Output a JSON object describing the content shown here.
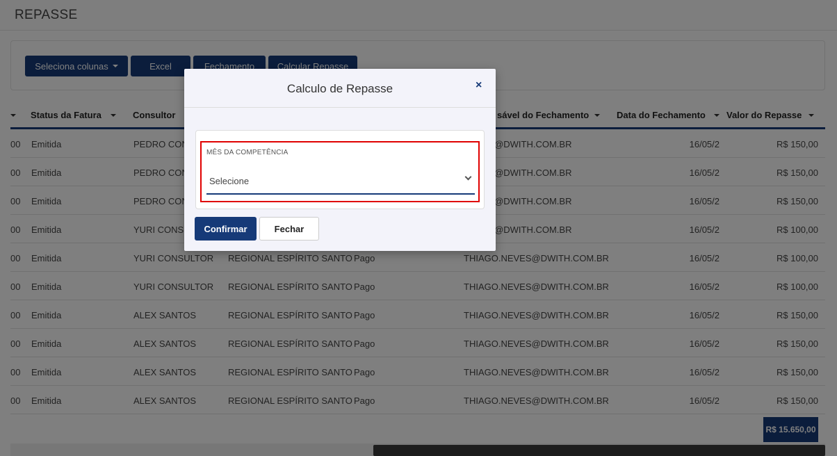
{
  "page": {
    "title": "REPASSE"
  },
  "toolbar": {
    "select_columns_label": "Seleciona colunas",
    "excel_label": "Excel",
    "fechamento_label": "Fechamento",
    "calcular_label": "Calcular Repasse"
  },
  "table": {
    "headers": {
      "status": "Status da Fatura",
      "consultor": "Consultor",
      "responsavel": "sável do Fechamento",
      "data": "Data do Fechamento",
      "valor": "Valor do Repasse"
    },
    "rows": [
      {
        "prefix": "00",
        "status": "Emitida",
        "consultor": "PEDRO CONS",
        "regional": "",
        "situacao": "",
        "responsavel": "NEVES@DWITH.COM.BR",
        "data": "16/05/2",
        "valor": "R$ 150,00"
      },
      {
        "prefix": "00",
        "status": "Emitida",
        "consultor": "PEDRO CONS",
        "regional": "",
        "situacao": "",
        "responsavel": "NEVES@DWITH.COM.BR",
        "data": "16/05/2",
        "valor": "R$ 150,00"
      },
      {
        "prefix": "00",
        "status": "Emitida",
        "consultor": "PEDRO CONS",
        "regional": "",
        "situacao": "",
        "responsavel": "NEVES@DWITH.COM.BR",
        "data": "16/05/2",
        "valor": "R$ 150,00"
      },
      {
        "prefix": "00",
        "status": "Emitida",
        "consultor": "YURI CONSU",
        "regional": "",
        "situacao": "",
        "responsavel": "NEVES@DWITH.COM.BR",
        "data": "16/05/2",
        "valor": "R$ 100,00"
      },
      {
        "prefix": "00",
        "status": "Emitida",
        "consultor": "YURI CONSULTOR",
        "regional": "REGIONAL ESPÍRITO SANTO",
        "situacao": "Pago",
        "responsavel": "THIAGO.NEVES@DWITH.COM.BR",
        "data": "16/05/2",
        "valor": "R$ 100,00"
      },
      {
        "prefix": "00",
        "status": "Emitida",
        "consultor": "YURI CONSULTOR",
        "regional": "REGIONAL ESPÍRITO SANTO",
        "situacao": "Pago",
        "responsavel": "THIAGO.NEVES@DWITH.COM.BR",
        "data": "16/05/2",
        "valor": "R$ 100,00"
      },
      {
        "prefix": "00",
        "status": "Emitida",
        "consultor": "ALEX SANTOS",
        "regional": "REGIONAL ESPÍRITO SANTO",
        "situacao": "Pago",
        "responsavel": "THIAGO.NEVES@DWITH.COM.BR",
        "data": "16/05/2",
        "valor": "R$ 150,00"
      },
      {
        "prefix": "00",
        "status": "Emitida",
        "consultor": "ALEX SANTOS",
        "regional": "REGIONAL ESPÍRITO SANTO",
        "situacao": "Pago",
        "responsavel": "THIAGO.NEVES@DWITH.COM.BR",
        "data": "16/05/2",
        "valor": "R$ 150,00"
      },
      {
        "prefix": "00",
        "status": "Emitida",
        "consultor": "ALEX SANTOS",
        "regional": "REGIONAL ESPÍRITO SANTO",
        "situacao": "Pago",
        "responsavel": "THIAGO.NEVES@DWITH.COM.BR",
        "data": "16/05/2",
        "valor": "R$ 150,00"
      },
      {
        "prefix": "00",
        "status": "Emitida",
        "consultor": "ALEX SANTOS",
        "regional": "REGIONAL ESPÍRITO SANTO",
        "situacao": "Pago",
        "responsavel": "THIAGO.NEVES@DWITH.COM.BR",
        "data": "16/05/2",
        "valor": "R$ 150,00"
      }
    ],
    "total": "R$ 15.650,00"
  },
  "modal": {
    "title": "Calculo de Repasse",
    "close_glyph": "×",
    "field_label": "MÊS DA COMPETÊNCIA",
    "select_value": "Selecione",
    "confirm_label": "Confirmar",
    "close_label": "Fechar"
  },
  "colors": {
    "primary": "#163a78",
    "highlight": "#e00000"
  }
}
